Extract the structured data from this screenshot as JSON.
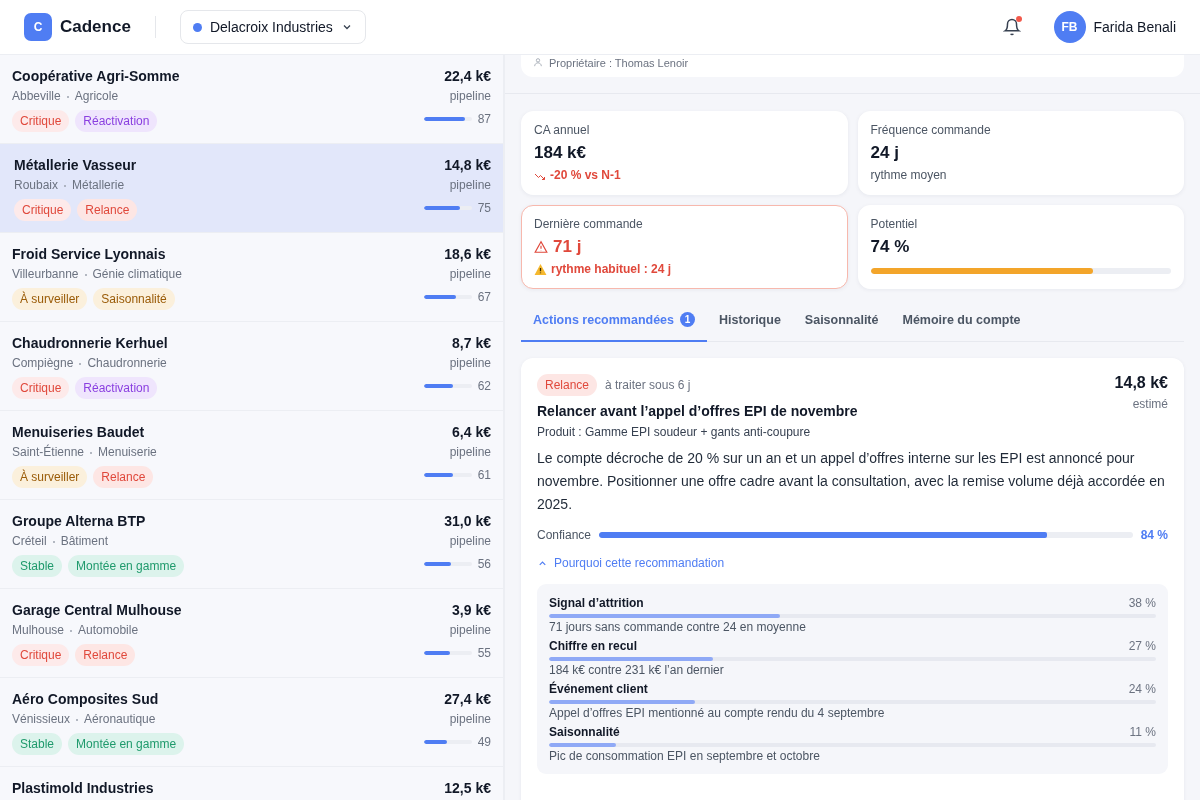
{
  "header": {
    "logo": "C",
    "app_name": "Cadence",
    "org": "Delacroix Industries",
    "unread": true,
    "avatar": "FB",
    "user": "Farida Benali"
  },
  "accounts": [
    {
      "name": "Coopérative Agri-Somme",
      "city": "Abbeville",
      "sector": "Agricole",
      "amount": "22,4 k€",
      "amount_label": "pipeline",
      "score": "87",
      "level": 0.87,
      "selected": false,
      "tags": [
        {
          "label": "Critique",
          "kind": "critical"
        },
        {
          "label": "Réactivation",
          "kind": "reactivation"
        }
      ]
    },
    {
      "name": "Métallerie Vasseur",
      "city": "Roubaix",
      "sector": "Métallerie",
      "amount": "14,8 k€",
      "amount_label": "pipeline",
      "score": "75",
      "level": 0.75,
      "selected": true,
      "tags": [
        {
          "label": "Critique",
          "kind": "critical"
        },
        {
          "label": "Relance",
          "kind": "followup"
        }
      ]
    },
    {
      "name": "Froid Service Lyonnais",
      "city": "Villeurbanne",
      "sector": "Génie climatique",
      "amount": "18,6 k€",
      "amount_label": "pipeline",
      "score": "67",
      "level": 0.67,
      "selected": false,
      "tags": [
        {
          "label": "À surveiller",
          "kind": "watch"
        },
        {
          "label": "Saisonnalité",
          "kind": "seasonal"
        }
      ]
    },
    {
      "name": "Chaudronnerie Kerhuel",
      "city": "Compiègne",
      "sector": "Chaudronnerie",
      "amount": "8,7 k€",
      "amount_label": "pipeline",
      "score": "62",
      "level": 0.62,
      "selected": false,
      "tags": [
        {
          "label": "Critique",
          "kind": "critical"
        },
        {
          "label": "Réactivation",
          "kind": "reactivation"
        }
      ]
    },
    {
      "name": "Menuiseries Baudet",
      "city": "Saint-Étienne",
      "sector": "Menuiserie",
      "amount": "6,4 k€",
      "amount_label": "pipeline",
      "score": "61",
      "level": 0.61,
      "selected": false,
      "tags": [
        {
          "label": "À surveiller",
          "kind": "watch"
        },
        {
          "label": "Relance",
          "kind": "followup"
        }
      ]
    },
    {
      "name": "Groupe Alterna BTP",
      "city": "Créteil",
      "sector": "Bâtiment",
      "amount": "31,0 k€",
      "amount_label": "pipeline",
      "score": "56",
      "level": 0.56,
      "selected": false,
      "tags": [
        {
          "label": "Stable",
          "kind": "stable"
        },
        {
          "label": "Montée en gamme",
          "kind": "upsell"
        }
      ]
    },
    {
      "name": "Garage Central Mulhouse",
      "city": "Mulhouse",
      "sector": "Automobile",
      "amount": "3,9 k€",
      "amount_label": "pipeline",
      "score": "55",
      "level": 0.55,
      "selected": false,
      "tags": [
        {
          "label": "Critique",
          "kind": "critical"
        },
        {
          "label": "Relance",
          "kind": "followup"
        }
      ]
    },
    {
      "name": "Aéro Composites Sud",
      "city": "Vénissieux",
      "sector": "Aéronautique",
      "amount": "27,4 k€",
      "amount_label": "pipeline",
      "score": "49",
      "level": 0.49,
      "selected": false,
      "tags": [
        {
          "label": "Stable",
          "kind": "stable"
        },
        {
          "label": "Montée en gamme",
          "kind": "upsell"
        }
      ]
    },
    {
      "name": "Plastimold Industries",
      "amount": "12,5 k€",
      "selected": false
    }
  ],
  "owner": "Propriétaire : Thomas Lenoir",
  "metrics": [
    {
      "kind": "trend",
      "label": "CA annuel",
      "value": "184 k€",
      "note": "-20 % vs N-1"
    },
    {
      "kind": "plain",
      "label": "Fréquence commande",
      "value": "24 j",
      "note": "rythme moyen"
    },
    {
      "kind": "alert",
      "label": "Dernière commande",
      "value": "71 j",
      "note": "rythme habituel : 24 j"
    },
    {
      "kind": "progress",
      "label": "Potentiel",
      "value": "74 %",
      "level": 0.74
    }
  ],
  "tabs": [
    {
      "label": "Actions recommandées",
      "badge": "1",
      "selected": true
    },
    {
      "label": "Historique",
      "selected": false
    },
    {
      "label": "Saisonnalité",
      "selected": false
    },
    {
      "label": "Mémoire du compte",
      "selected": false
    }
  ],
  "action": {
    "tag": {
      "label": "Relance",
      "kind": "followup"
    },
    "due": "à traiter sous 6 j",
    "amount": "14,8 k€",
    "amount_label": "estimé",
    "title": "Relancer avant l’appel d’offres EPI de novembre",
    "product": "Produit : Gamme EPI soudeur + gants anti-coupure",
    "description": "Le compte décroche de 20 % sur un an et un appel d’offres interne sur les EPI est annoncé pour novembre. Positionner une offre cadre avant la consultation, avec la remise volume déjà accordée en 2025.",
    "confidence_label": "Confiance",
    "confidence": "84 %",
    "level": 0.84,
    "why": "Pourquoi cette recommandation",
    "expanded": true,
    "reasons": [
      {
        "name": "Signal d’attrition",
        "share": "38 %",
        "level": 0.38,
        "detail": "71 jours sans commande contre 24 en moyenne"
      },
      {
        "name": "Chiffre en recul",
        "share": "27 %",
        "level": 0.27,
        "detail": "184 k€ contre 231 k€ l’an dernier"
      },
      {
        "name": "Événement client",
        "share": "24 %",
        "level": 0.24,
        "detail": "Appel d’offres EPI mentionné au compte rendu du 4 septembre"
      },
      {
        "name": "Saisonnalité",
        "share": "11 %",
        "level": 0.11,
        "detail": "Pic de consommation EPI en septembre et octobre"
      }
    ]
  }
}
